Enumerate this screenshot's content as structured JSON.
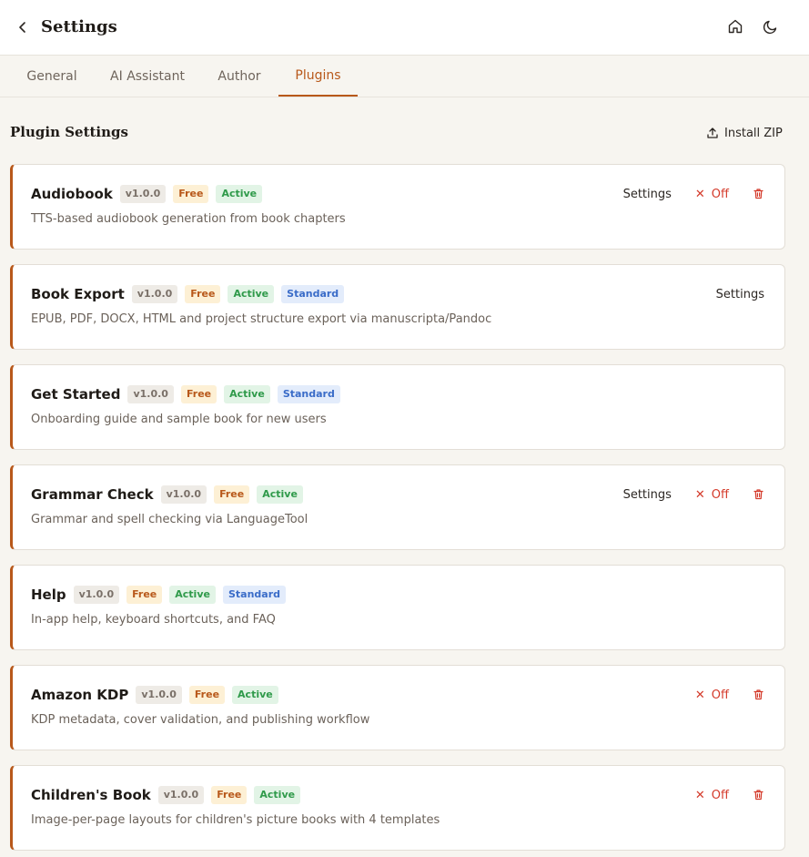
{
  "header": {
    "title": "Settings",
    "back_icon": "chevron-left-icon",
    "home_icon": "home-icon",
    "theme_icon": "moon-icon"
  },
  "tabs": [
    {
      "label": "General"
    },
    {
      "label": "AI Assistant"
    },
    {
      "label": "Author"
    },
    {
      "label": "Plugins",
      "active": true
    }
  ],
  "section": {
    "title": "Plugin Settings",
    "install_label": "Install ZIP"
  },
  "plugins": [
    {
      "name": "Audiobook",
      "version": "v1.0.0",
      "free": "Free",
      "status": "Active",
      "standard": "",
      "description": "TTS-based audiobook generation from book chapters",
      "settings": "Settings",
      "off": "Off",
      "deletable": true
    },
    {
      "name": "Book Export",
      "version": "v1.0.0",
      "free": "Free",
      "status": "Active",
      "standard": "Standard",
      "description": "EPUB, PDF, DOCX, HTML and project structure export via manuscripta/Pandoc",
      "settings": "Settings",
      "off": "",
      "deletable": false
    },
    {
      "name": "Get Started",
      "version": "v1.0.0",
      "free": "Free",
      "status": "Active",
      "standard": "Standard",
      "description": "Onboarding guide and sample book for new users",
      "settings": "",
      "off": "",
      "deletable": false
    },
    {
      "name": "Grammar Check",
      "version": "v1.0.0",
      "free": "Free",
      "status": "Active",
      "standard": "",
      "description": "Grammar and spell checking via LanguageTool",
      "settings": "Settings",
      "off": "Off",
      "deletable": true
    },
    {
      "name": "Help",
      "version": "v1.0.0",
      "free": "Free",
      "status": "Active",
      "standard": "Standard",
      "description": "In-app help, keyboard shortcuts, and FAQ",
      "settings": "",
      "off": "",
      "deletable": false
    },
    {
      "name": "Amazon KDP",
      "version": "v1.0.0",
      "free": "Free",
      "status": "Active",
      "standard": "",
      "description": "KDP metadata, cover validation, and publishing workflow",
      "settings": "",
      "off": "Off",
      "deletable": true
    },
    {
      "name": "Children's Book",
      "version": "v1.0.0",
      "free": "Free",
      "status": "Active",
      "standard": "",
      "description": "Image-per-page layouts for children's picture books with 4 templates",
      "settings": "",
      "off": "Off",
      "deletable": true
    }
  ],
  "colors": {
    "accent": "#b8581a",
    "off_red": "#d43a2a",
    "background": "#f7f5f0"
  }
}
